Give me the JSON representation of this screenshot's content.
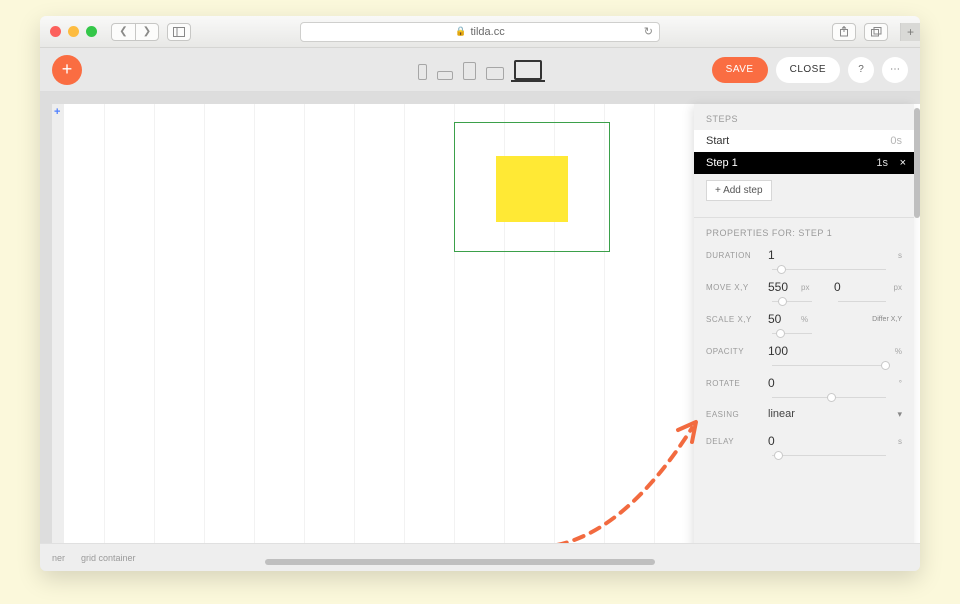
{
  "browser": {
    "url": "tilda.cc"
  },
  "toolbar": {
    "save_label": "SAVE",
    "close_label": "CLOSE"
  },
  "steps_panel": {
    "title": "STEPS",
    "start_label": "Start",
    "start_time": "0s",
    "active_label": "Step 1",
    "active_time": "1s",
    "add_step_label": "+ Add step"
  },
  "properties": {
    "title": "PROPERTIES FOR: STEP 1",
    "duration": {
      "label": "DURATION",
      "value": "1",
      "unit": "s"
    },
    "move": {
      "label": "MOVE X,Y",
      "x": "550",
      "y": "0",
      "unit": "px"
    },
    "scale": {
      "label": "SCALE X,Y",
      "value": "50",
      "unit": "%",
      "differ": "Differ X,Y"
    },
    "opacity": {
      "label": "OPACITY",
      "value": "100",
      "unit": "%"
    },
    "rotate": {
      "label": "ROTATE",
      "value": "0",
      "unit": "°"
    },
    "easing": {
      "label": "EASING",
      "value": "linear"
    },
    "delay": {
      "label": "DELAY",
      "value": "0",
      "unit": "s"
    }
  },
  "status_bar": {
    "item1": "ner",
    "item2": "grid container"
  }
}
